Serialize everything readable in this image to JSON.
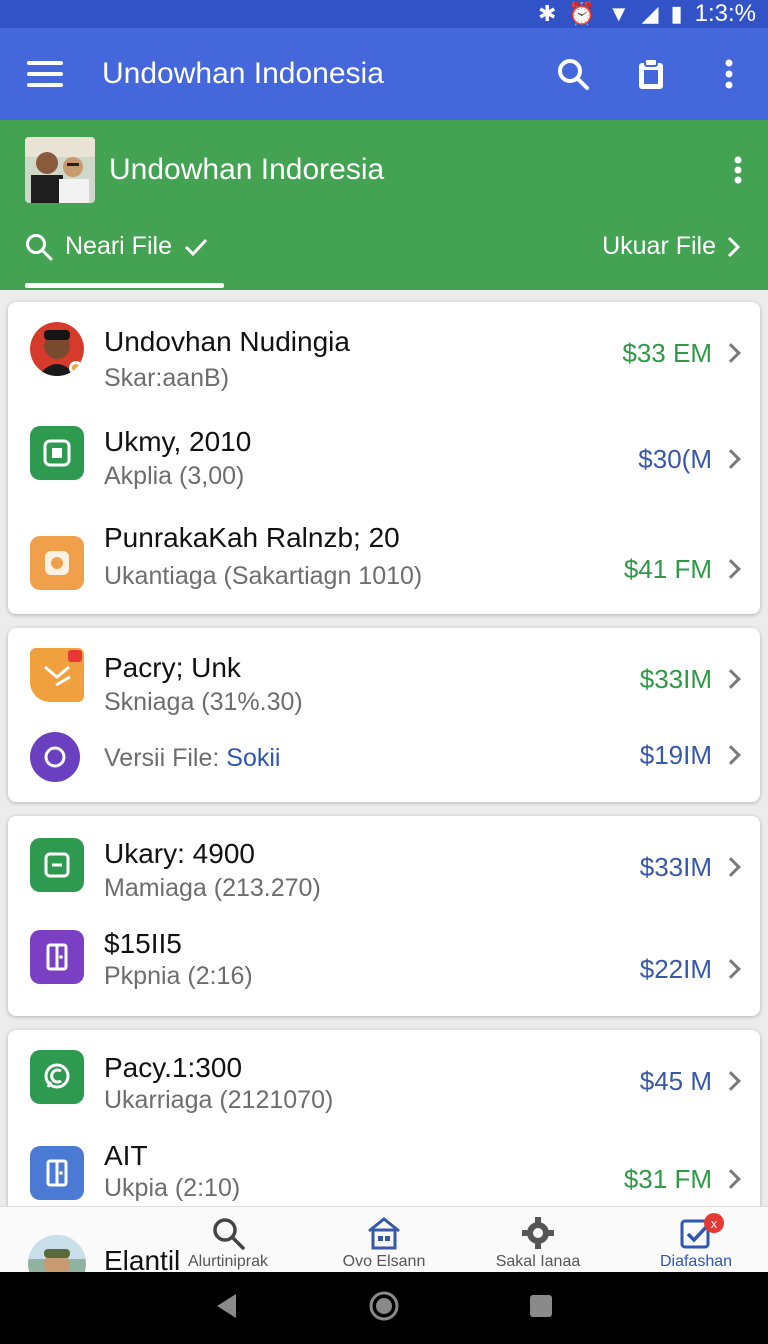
{
  "status_bar": {
    "time": "1:3:%"
  },
  "app_bar": {
    "title": "Undowhan Indonesia"
  },
  "header": {
    "title": "Undowhan Indoresia",
    "tab_left": "Neari File",
    "tab_right": "Ukuar File"
  },
  "cards": [
    {
      "items": [
        {
          "name": "Undovhan Nudingia",
          "sub": "Skar:aanB)",
          "amount": "$33 EM",
          "icon": "avatar-photo",
          "amount_color": "green"
        },
        {
          "name": "Ukmy, 2010",
          "sub": "Akplia (3,00)",
          "amount": "$30(M",
          "icon": "green-square-app-icon",
          "amount_color": "blue"
        },
        {
          "name": "PunrakaKah Ralnzb; 20",
          "sub": "Ukantiaga (Sakartiagn 1010)",
          "amount": "$41 FM",
          "icon": "orange-app-icon",
          "amount_color": "green"
        }
      ]
    },
    {
      "items": [
        {
          "name": "Pacry; Unk",
          "sub": "Skniaga (31%.30)",
          "amount": "$33IM",
          "icon": "orange-mail-icon",
          "amount_color": "green"
        },
        {
          "name": "",
          "sub_prefix": "Versii File:",
          "sub_link": "Sokii",
          "amount": "$19IM",
          "icon": "purple-circle-icon",
          "amount_color": "blue"
        }
      ]
    },
    {
      "items": [
        {
          "name": "Ukary: 4900",
          "sub": "Mamiaga (213.270)",
          "amount": "$33IM",
          "icon": "green-doc-icon",
          "amount_color": "blue"
        },
        {
          "name": "$15II5",
          "sub": "Pkpnia (2:16)",
          "amount": "$22IM",
          "icon": "purple-door-icon",
          "amount_color": "blue"
        }
      ]
    },
    {
      "items": [
        {
          "name": "Pacy.1:300",
          "sub": "Ukarriaga (2121070)",
          "amount": "$45 M",
          "icon": "green-chat-icon",
          "amount_color": "blue"
        },
        {
          "name": "AIT",
          "sub": "Ukpia (2:10)",
          "amount": "$31 FM",
          "icon": "blue-door-icon",
          "amount_color": "green"
        }
      ]
    }
  ],
  "bottom_nav": {
    "user_name": "Elantil",
    "items": [
      {
        "label": "Alurtiniprak",
        "icon": "search-icon"
      },
      {
        "label": "Ovo Elsann",
        "icon": "home-icon"
      },
      {
        "label": "Sakal Ianaa",
        "icon": "gear-icon"
      },
      {
        "label": "Diafashan",
        "icon": "checklist-icon",
        "badge": "x"
      }
    ]
  },
  "colors": {
    "status_bar": "#3252c8",
    "app_bar": "#4468dc",
    "header": "#43a352",
    "amount_green": "#2e9a46",
    "amount_blue": "#3858a8"
  }
}
